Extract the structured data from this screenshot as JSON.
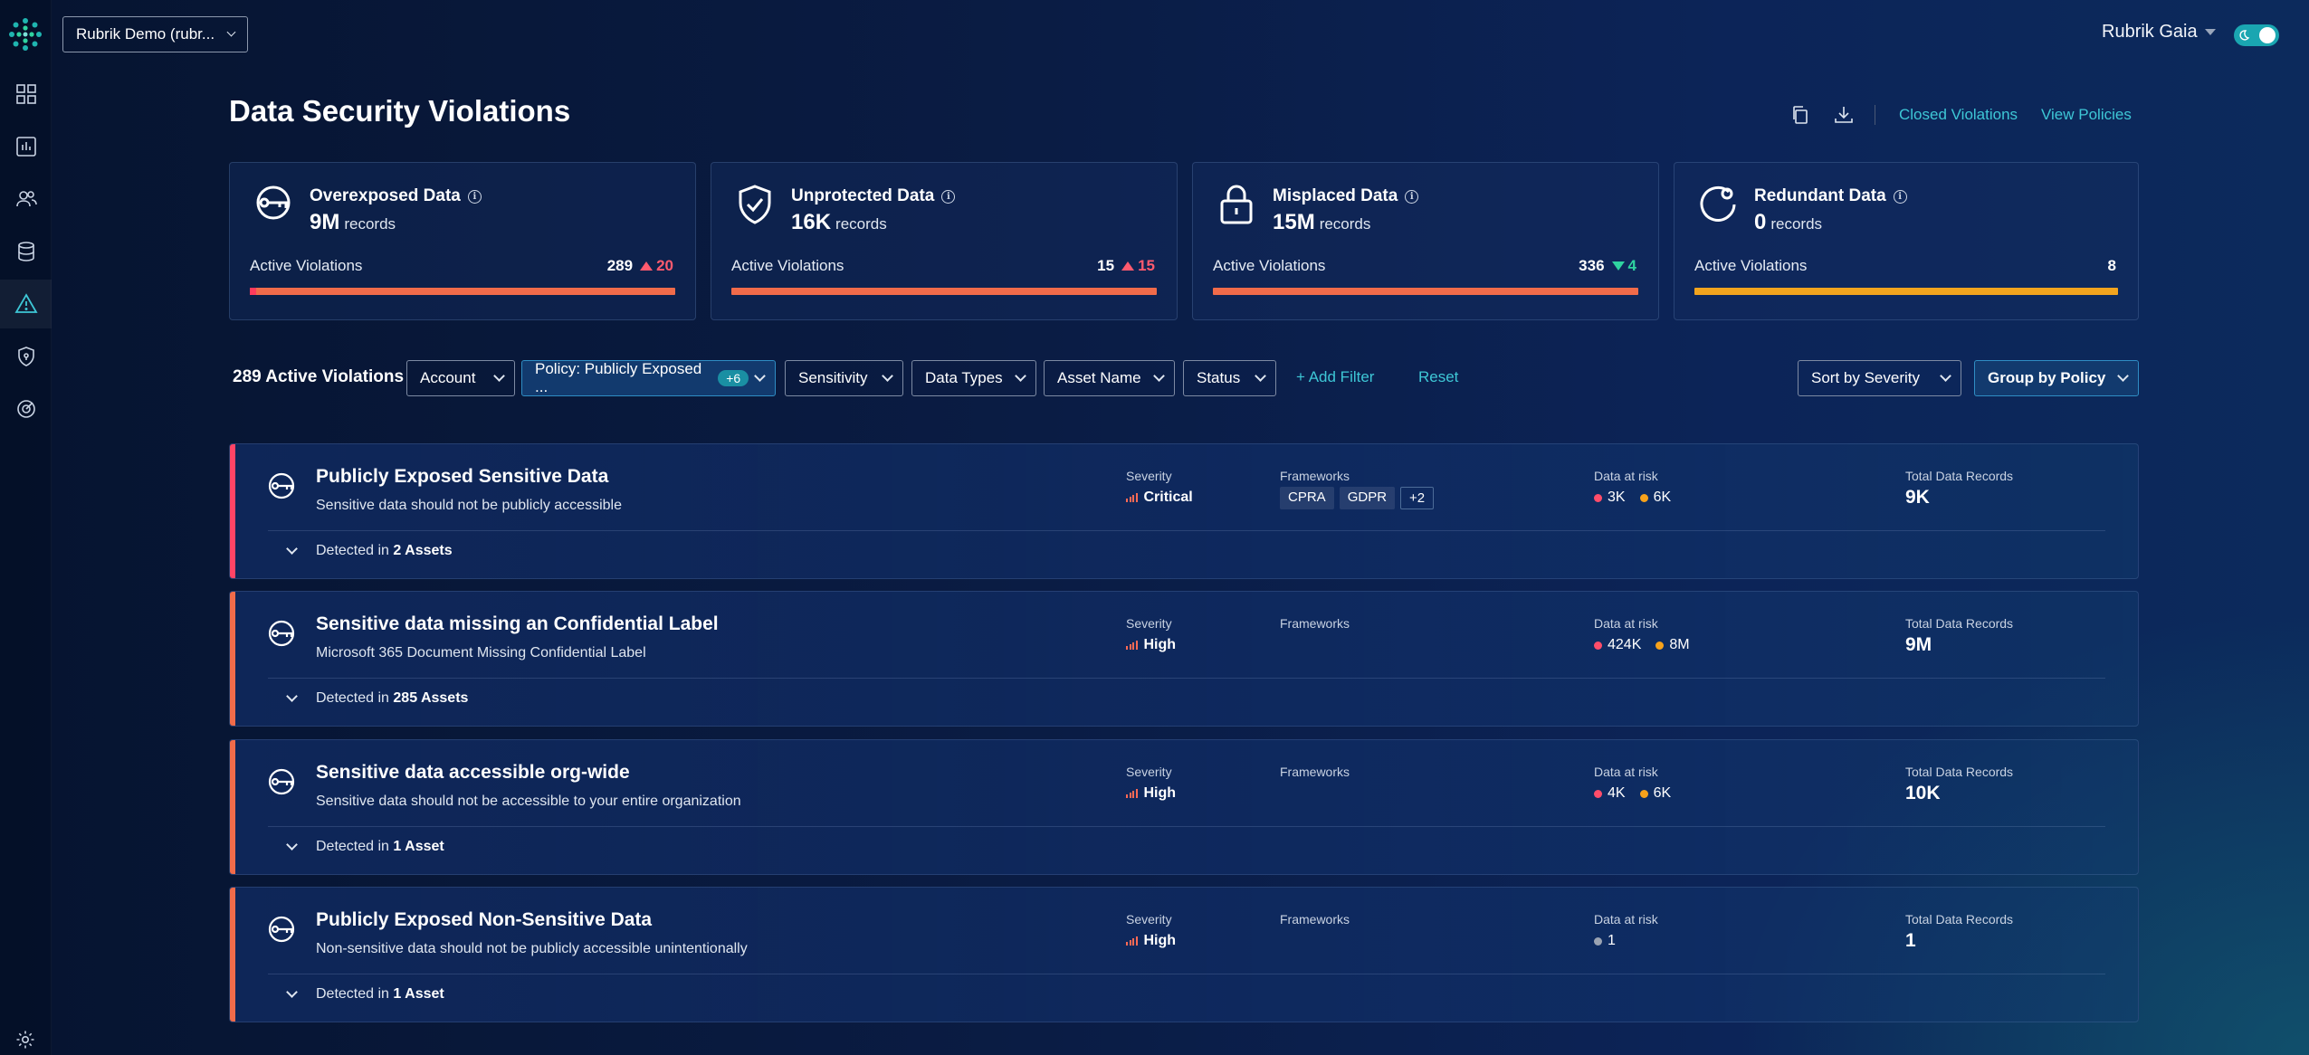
{
  "account_select": {
    "value": "Rubrik Demo (rubr..."
  },
  "user": {
    "name": "Rubrik Gaia"
  },
  "header": {
    "title": "Data Security Violations",
    "links": {
      "closed": "Closed Violations",
      "policies": "View Policies"
    }
  },
  "cards": [
    {
      "title": "Overexposed Data",
      "value": "9M",
      "unit": "records",
      "label": "Active Violations",
      "count": "289",
      "delta": "20",
      "direction": "up",
      "icon": "key-icon",
      "bar_color": "#f06b4a"
    },
    {
      "title": "Unprotected Data",
      "value": "16K",
      "unit": "records",
      "label": "Active Violations",
      "count": "15",
      "delta": "15",
      "direction": "up",
      "icon": "shield-check-icon",
      "bar_color": "#f06b4a"
    },
    {
      "title": "Misplaced Data",
      "value": "15M",
      "unit": "records",
      "label": "Active Violations",
      "count": "336",
      "delta": "4",
      "direction": "down",
      "icon": "lock-icon",
      "bar_color": "#f06b4a"
    },
    {
      "title": "Redundant Data",
      "value": "0",
      "unit": "records",
      "label": "Active Violations",
      "count": "8",
      "delta": "",
      "direction": "none",
      "icon": "circle-arrow-icon",
      "bar_color": "#f2a41e"
    }
  ],
  "filters": {
    "count_label": "289 Active Violations",
    "account": "Account",
    "policy": "Policy: Publicly Exposed ...",
    "policy_badge": "+6",
    "sensitivity": "Sensitivity",
    "data_types": "Data Types",
    "asset_name": "Asset Name",
    "status": "Status",
    "add_filter": "+ Add Filter",
    "reset": "Reset",
    "sort": "Sort by Severity",
    "group": "Group by Policy"
  },
  "labels": {
    "severity": "Severity",
    "frameworks": "Frameworks",
    "data_at_risk": "Data at risk",
    "total_records": "Total Data Records",
    "detected_prefix": "Detected in"
  },
  "violations": [
    {
      "title": "Publicly Exposed Sensitive Data",
      "description": "Sensitive data should not be publicly accessible",
      "severity": "Critical",
      "frameworks": [
        "CPRA",
        "GDPR"
      ],
      "frameworks_more": "+2",
      "risk_high": "3K",
      "risk_medium": "6K",
      "total": "9K",
      "detected": "2 Assets",
      "stripe": "#ff4466"
    },
    {
      "title": "Sensitive data missing an Confidential Label",
      "description": "Microsoft 365 Document Missing Confidential Label",
      "severity": "High",
      "frameworks": [],
      "risk_high": "424K",
      "risk_medium": "8M",
      "total": "9M",
      "detected": "285 Assets",
      "stripe": "#f06b4a"
    },
    {
      "title": "Sensitive data accessible org-wide",
      "description": "Sensitive data should not be accessible to your entire organization",
      "severity": "High",
      "frameworks": [],
      "risk_high": "4K",
      "risk_medium": "6K",
      "total": "10K",
      "detected": "1 Asset",
      "stripe": "#f06b4a"
    },
    {
      "title": "Publicly Exposed Non-Sensitive Data",
      "description": "Non-sensitive data should not be publicly accessible unintentionally",
      "severity": "High",
      "frameworks": [],
      "risk_low": "1",
      "total": "1",
      "detected": "1 Asset",
      "stripe": "#f06b4a"
    }
  ],
  "colors": {
    "accent": "#3ec7d6",
    "risk_high": "#ff4d6a",
    "risk_medium": "#f7a21b",
    "risk_low": "#9aa3b2"
  }
}
